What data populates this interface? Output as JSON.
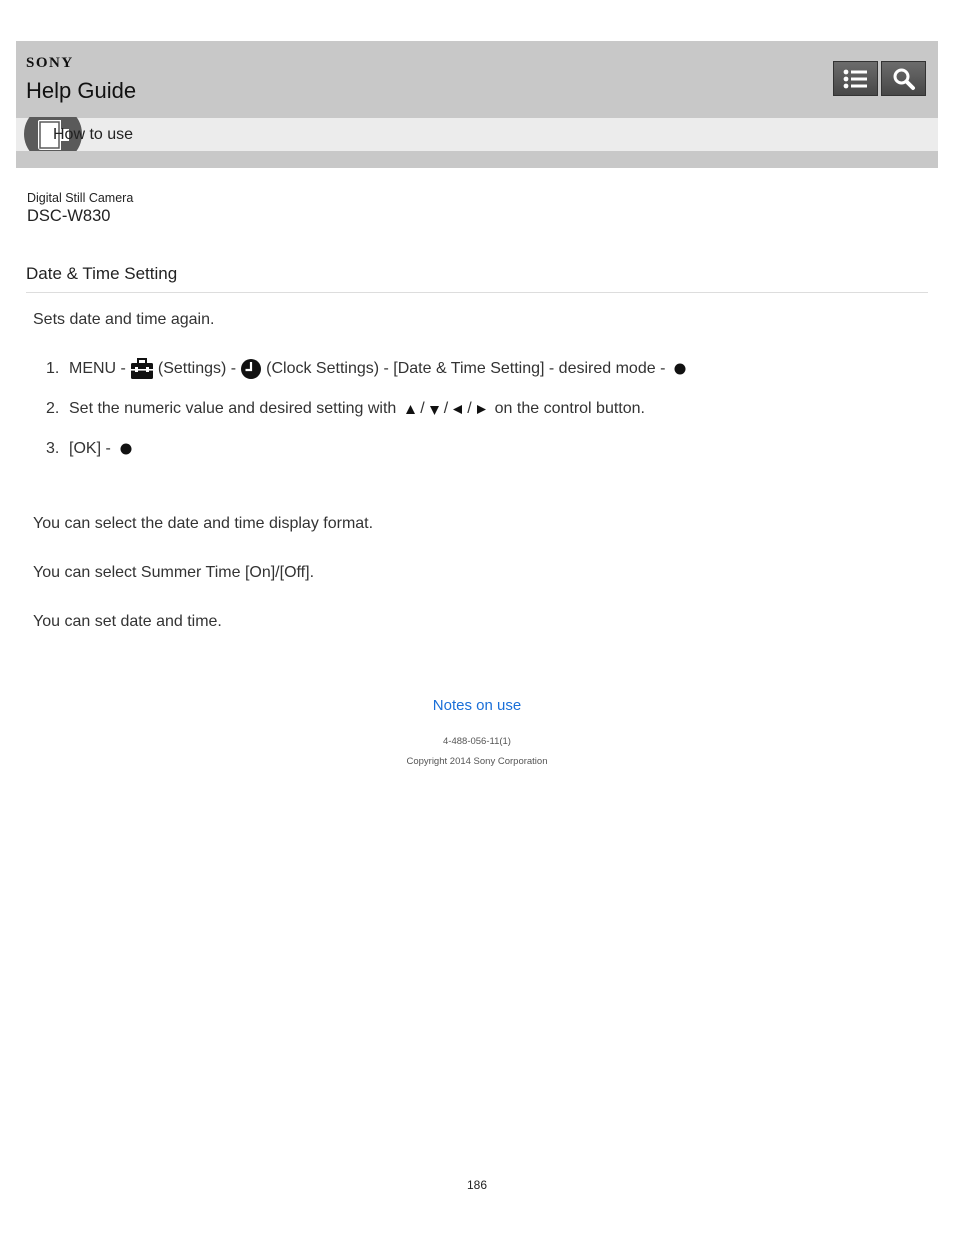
{
  "header": {
    "brand": "SONY",
    "title": "Help Guide",
    "breadcrumb": "How to use"
  },
  "product": {
    "type": "Digital Still Camera",
    "model": "DSC-W830"
  },
  "page": {
    "title": "Date & Time Setting",
    "intro": "Sets date and time again."
  },
  "steps": [
    {
      "number": "1.",
      "parts": [
        "MENU -",
        "(Settings) -",
        "(Clock Settings) - [Date & Time Setting] - desired mode -"
      ]
    },
    {
      "number": "2.",
      "parts": [
        "Set the numeric value and desired setting with",
        "/",
        "/",
        "/",
        "on the control button."
      ]
    },
    {
      "number": "3.",
      "parts": [
        "[OK] -"
      ]
    }
  ],
  "notes": [
    "You can select the date and time display format.",
    "You can select Summer Time [On]/[Off].",
    "You can set date and time."
  ],
  "footer": {
    "link": "Notes on use",
    "doc_number": "4-488-056-11(1)",
    "copyright": "Copyright 2014 Sony Corporation",
    "page_number": "186"
  },
  "icons": {
    "header_list": "list-icon",
    "header_search": "search-icon",
    "breadcrumb": "book-icon",
    "settings": "toolbox-icon",
    "clock": "clock-icon",
    "center_button": "center-button-icon",
    "up": "triangle-up-icon",
    "down": "triangle-down-icon",
    "left": "triangle-left-icon",
    "right": "triangle-right-icon"
  },
  "colors": {
    "header_bg": "#c8c8c8",
    "subbar_bg": "#ececec",
    "link": "#1a6fd8"
  }
}
